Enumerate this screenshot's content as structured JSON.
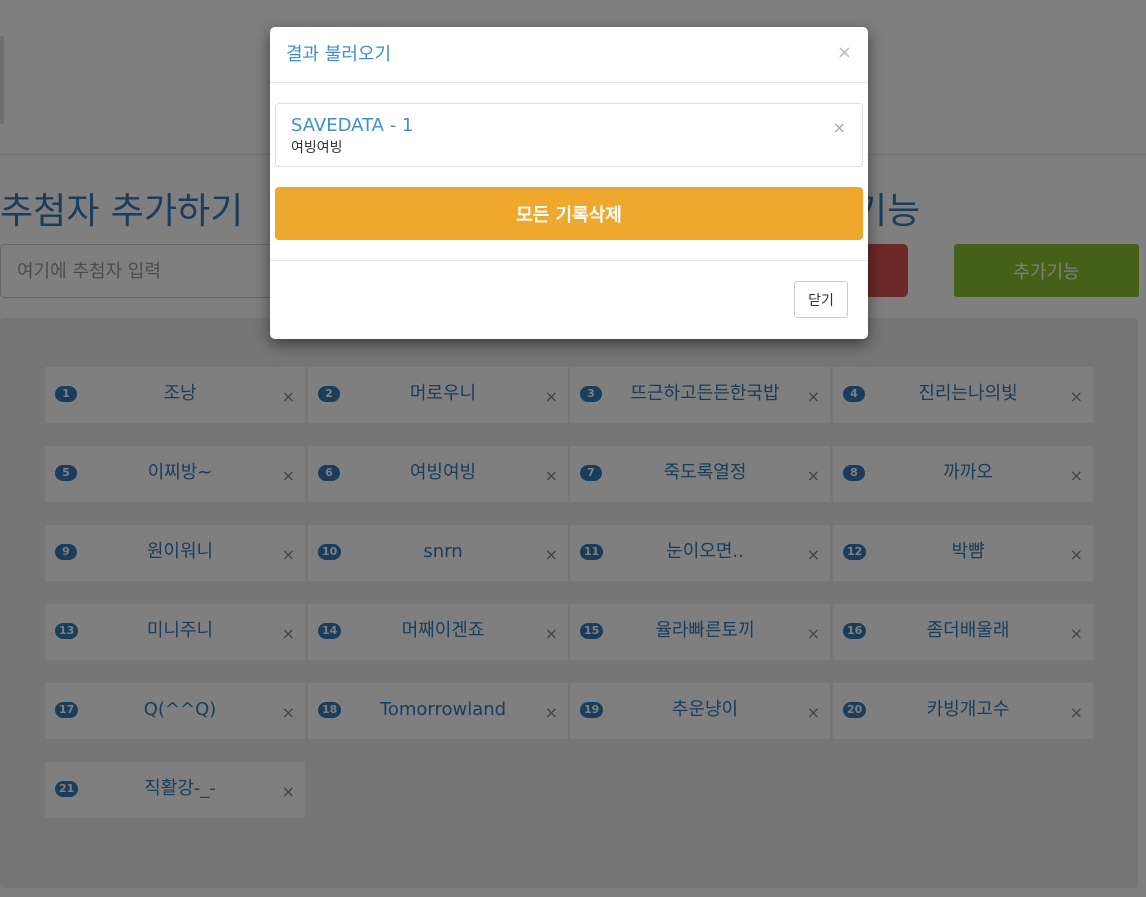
{
  "page": {
    "section_title_left": "추첨자 추가하기",
    "section_title_right": "기능",
    "name_input_placeholder": "여기에 추첨자 입력",
    "extra_button_label": "추가기능"
  },
  "participants": [
    {
      "num": "1",
      "name": "조낭"
    },
    {
      "num": "2",
      "name": "머로우니"
    },
    {
      "num": "3",
      "name": "뜨근하고든든한국밥"
    },
    {
      "num": "4",
      "name": "진리는나의빛"
    },
    {
      "num": "5",
      "name": "이찌방~"
    },
    {
      "num": "6",
      "name": "여빙여빙"
    },
    {
      "num": "7",
      "name": "죽도록열정"
    },
    {
      "num": "8",
      "name": "까까오"
    },
    {
      "num": "9",
      "name": "원이워니"
    },
    {
      "num": "10",
      "name": "snrn"
    },
    {
      "num": "11",
      "name": "눈이오면.."
    },
    {
      "num": "12",
      "name": "박뺨"
    },
    {
      "num": "13",
      "name": "미니주니"
    },
    {
      "num": "14",
      "name": "머째이겐죠"
    },
    {
      "num": "15",
      "name": "율라빠른토끼"
    },
    {
      "num": "16",
      "name": "좀더배울래"
    },
    {
      "num": "17",
      "name": "Q(^^Q)"
    },
    {
      "num": "18",
      "name": "Tomorrowland"
    },
    {
      "num": "19",
      "name": "추운냥이"
    },
    {
      "num": "20",
      "name": "카빙개고수"
    },
    {
      "num": "21",
      "name": "직활강-_-"
    }
  ],
  "tag_remove_glyph": "×",
  "modal": {
    "title": "결과 불러오기",
    "close_glyph": "×",
    "save_item": {
      "name": "SAVEDATA - 1",
      "detail": "여빙여빙",
      "remove_glyph": "×"
    },
    "delete_all_label": "모든 기록삭제",
    "close_label": "닫기"
  },
  "colors": {
    "primary": "#337ab7",
    "warning": "#eea82e",
    "danger": "#d9534f",
    "success": "#8ac12f"
  }
}
